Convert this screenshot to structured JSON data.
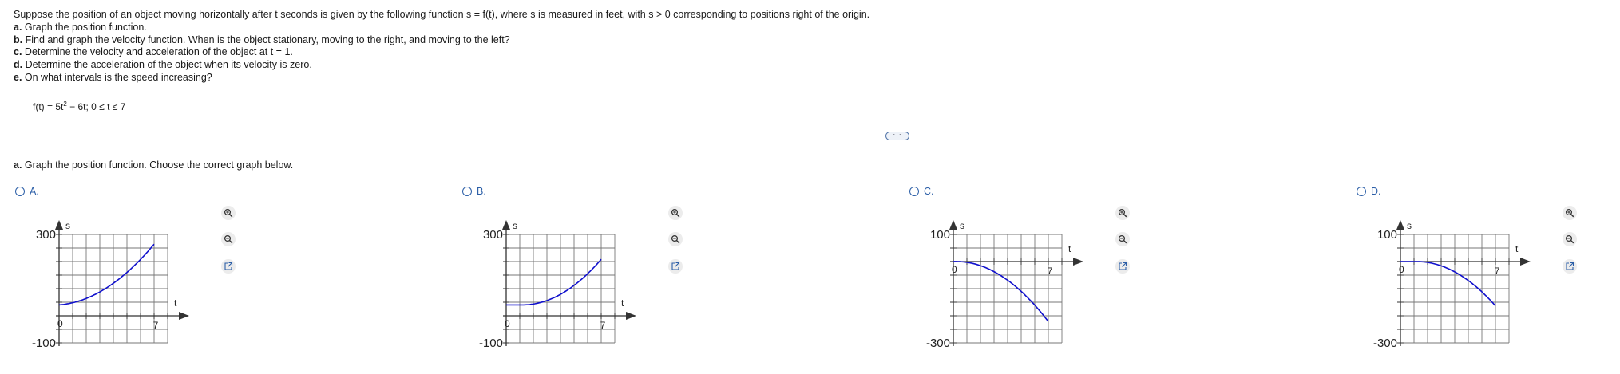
{
  "problem": {
    "intro": "Suppose the position of an object moving horizontally after t seconds is given by the following function s = f(t), where s is measured in feet, with s > 0 corresponding to positions right of the origin.",
    "parts": [
      {
        "letter": "a.",
        "text": " Graph the position function."
      },
      {
        "letter": "b.",
        "text": " Find and graph the velocity function. When is the object stationary, moving to the right, and moving to the left?"
      },
      {
        "letter": "c.",
        "text": " Determine the velocity and acceleration of the object at t = 1."
      },
      {
        "letter": "d.",
        "text": " Determine the acceleration of the object when its velocity is zero."
      },
      {
        "letter": "e.",
        "text": " On what intervals is the speed increasing?"
      }
    ],
    "function_prefix": "f(t) = 5t",
    "function_exp": "2",
    "function_suffix": " − 6t; 0 ≤ t ≤ 7"
  },
  "question": {
    "letter": "a.",
    "text": " Graph the position function. Choose the correct graph below."
  },
  "more_button": "···",
  "options": [
    {
      "letter": "A.",
      "ymax_label": "300",
      "ymin_label": "-100",
      "y_axis": "s",
      "x_axis": "t",
      "x_tick": "7",
      "origin": "0"
    },
    {
      "letter": "B.",
      "ymax_label": "300",
      "ymin_label": "-100",
      "y_axis": "s",
      "x_axis": "t",
      "x_tick": "7",
      "origin": "0"
    },
    {
      "letter": "C.",
      "ymax_label": "100",
      "ymin_label": "-300",
      "y_axis": "s",
      "x_axis": "t",
      "x_tick": "7",
      "origin": "0"
    },
    {
      "letter": "D.",
      "ymax_label": "100",
      "ymin_label": "-300",
      "y_axis": "s",
      "x_axis": "t",
      "x_tick": "7",
      "origin": "0"
    }
  ],
  "chart_data": [
    {
      "type": "line",
      "series": [
        {
          "x": [
            0,
            7
          ],
          "f": "5t^2 - 6t + 40"
        }
      ],
      "xlim": [
        0,
        8
      ],
      "ylim": [
        -100,
        300
      ],
      "grid": true
    },
    {
      "type": "line",
      "series": [
        {
          "x": [
            0,
            7
          ],
          "f": "5t^2 - 6t shifted"
        }
      ],
      "xlim": [
        0,
        8
      ],
      "ylim": [
        -100,
        300
      ],
      "grid": true
    },
    {
      "type": "line",
      "series": [
        {
          "x": [
            0,
            7
          ],
          "f": "-(5t^2 - 6t)"
        }
      ],
      "xlim": [
        0,
        8
      ],
      "ylim": [
        -300,
        100
      ],
      "grid": true
    },
    {
      "type": "line",
      "series": [
        {
          "x": [
            0,
            7
          ],
          "f": "-(5t^2 - 6t) shifted"
        }
      ],
      "xlim": [
        0,
        8
      ],
      "ylim": [
        -300,
        100
      ],
      "grid": true
    }
  ],
  "colors": {
    "curve": "#1010cc",
    "grid": "#777777",
    "accent": "#2b5ea7"
  },
  "icons": [
    "zoom-in-icon",
    "zoom-out-icon",
    "popout-icon"
  ]
}
